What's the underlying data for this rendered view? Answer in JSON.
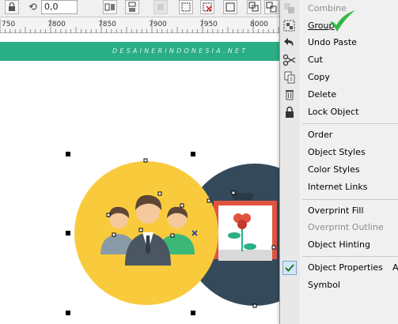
{
  "toolbar": {
    "rotation_value": "0,0",
    "rotation_icon": "rotate-icon"
  },
  "ruler": {
    "labels": [
      "750",
      "7800",
      "7850",
      "7900",
      "7950",
      "8000"
    ]
  },
  "banner": {
    "text": "DESAINERINDONESIA.NET",
    "color": "#2aae86"
  },
  "artwork": {
    "yellow_circle_color": "#f9cb3c",
    "dark_circle_color": "#34495a",
    "frame_color": "#e0543f"
  },
  "context_menu": {
    "items": [
      {
        "label": "Combine",
        "icon": "combine-icon",
        "disabled": true,
        "underline": ""
      },
      {
        "label": "Group",
        "icon": "group-icon",
        "disabled": false,
        "underline": "G"
      },
      {
        "label": "Undo Paste",
        "icon": "undo-icon",
        "disabled": false
      },
      {
        "label": "Cut",
        "icon": "scissors-icon",
        "disabled": false
      },
      {
        "label": "Copy",
        "icon": "copy-icon",
        "disabled": false
      },
      {
        "label": "Delete",
        "icon": "trash-icon",
        "disabled": false
      },
      {
        "label": "Lock Object",
        "icon": "lock-icon",
        "disabled": false
      },
      {
        "label": "Order",
        "icon": "",
        "disabled": false
      },
      {
        "label": "Object Styles",
        "icon": "",
        "disabled": false
      },
      {
        "label": "Color Styles",
        "icon": "",
        "disabled": false
      },
      {
        "label": "Internet Links",
        "icon": "",
        "disabled": false
      },
      {
        "label": "Overprint Fill",
        "icon": "",
        "disabled": false
      },
      {
        "label": "Overprint Outline",
        "icon": "",
        "disabled": true
      },
      {
        "label": "Object Hinting",
        "icon": "",
        "disabled": false
      },
      {
        "label": "Object Properties",
        "icon": "checkmark-icon",
        "disabled": false,
        "checked": true,
        "shortcut": "A"
      },
      {
        "label": "Symbol",
        "icon": "",
        "disabled": false
      }
    ],
    "annotation": "green-checkmark-icon"
  }
}
